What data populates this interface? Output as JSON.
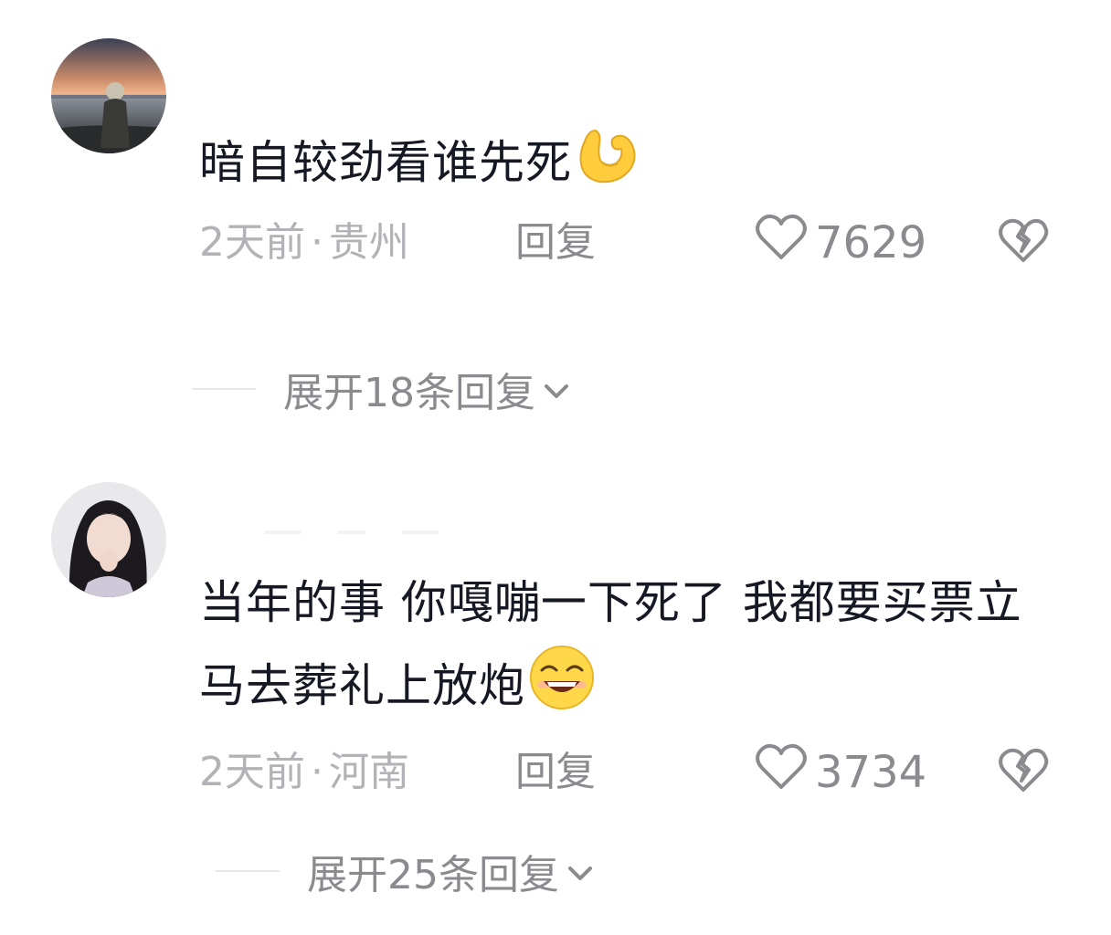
{
  "comments": [
    {
      "text": "暗自较劲看谁先死",
      "emoji": "flexed-biceps",
      "time": "2天前",
      "separator": "·",
      "location": "贵州",
      "reply_label": "回复",
      "likes": "7629",
      "expand_label": "展开18条回复"
    },
    {
      "text": "当年的事 你嘎嘣一下死了 我都要买票立马去葬礼上放炮",
      "emoji": "grinning-face",
      "time": "2天前",
      "separator": "·",
      "location": "河南",
      "reply_label": "回复",
      "likes": "3734",
      "expand_label": "展开25条回复"
    }
  ],
  "colors": {
    "text": "#161823",
    "meta": "#b3b3b7",
    "action": "#8a8a8f",
    "divider": "#e6e6e8"
  }
}
